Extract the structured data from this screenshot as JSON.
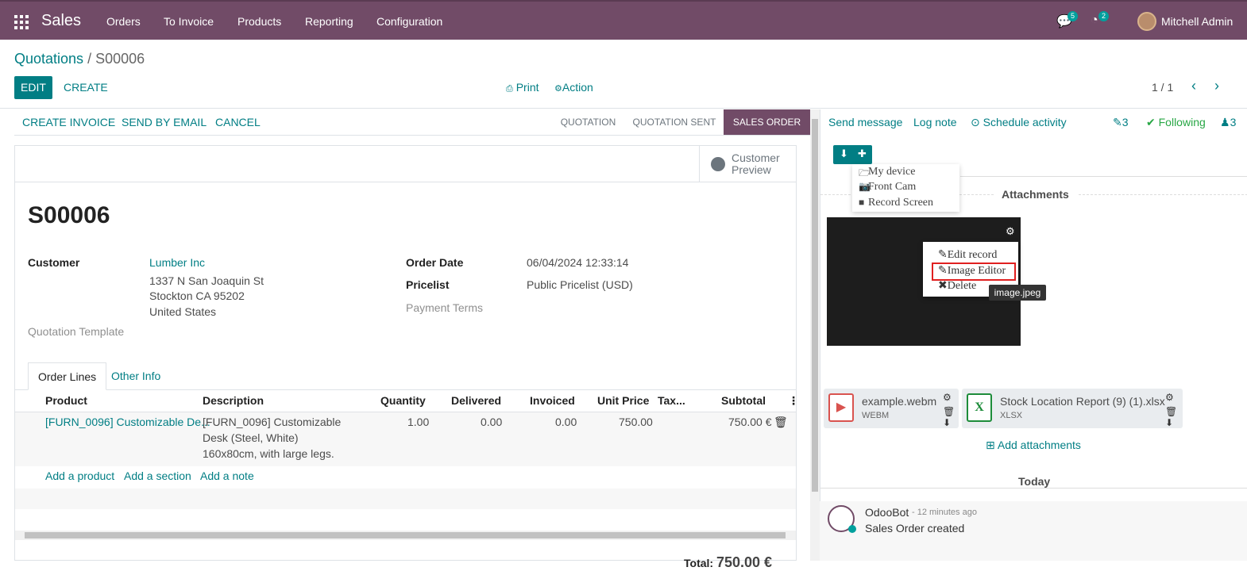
{
  "topbar": {
    "brand": "Sales",
    "menu": [
      "Orders",
      "To Invoice",
      "Products",
      "Reporting",
      "Configuration"
    ],
    "messages_count": "5",
    "activities_count": "2",
    "user": "Mitchell Admin"
  },
  "breadcrumb": {
    "parent": "Quotations",
    "separator": "/",
    "current": "S00006"
  },
  "actions": {
    "edit": "EDIT",
    "create": "CREATE",
    "print": "Print",
    "action": "Action"
  },
  "pager": {
    "text": "1 / 1",
    "prev": "‹",
    "next": "›"
  },
  "status_buttons": [
    "CREATE INVOICE",
    "SEND BY EMAIL",
    "CANCEL"
  ],
  "stages": {
    "items": [
      "QUOTATION",
      "QUOTATION SENT",
      "SALES ORDER"
    ],
    "active": "SALES ORDER"
  },
  "smart_button": {
    "label": "Customer Preview"
  },
  "record": {
    "name": "S00006",
    "customer_label": "Customer",
    "customer_name": "Lumber Inc",
    "address": [
      "1337 N San Joaquin St",
      "Stockton CA 95202",
      "United States"
    ],
    "template_label": "Quotation Template",
    "order_date_label": "Order Date",
    "order_date": "06/04/2024 12:33:14",
    "pricelist_label": "Pricelist",
    "pricelist": "Public Pricelist (USD)",
    "payment_terms_label": "Payment Terms"
  },
  "tabs": [
    "Order Lines",
    "Other Info"
  ],
  "table": {
    "headers": [
      "Product",
      "Description",
      "Quantity",
      "Delivered",
      "Invoiced",
      "Unit Price",
      "Tax...",
      "Subtotal"
    ],
    "row": {
      "product": "[FURN_0096] Customizable De...",
      "description": [
        "[FURN_0096] Customizable",
        "Desk (Steel, White)",
        "160x80cm, with large legs."
      ],
      "quantity": "1.00",
      "delivered": "0.00",
      "invoiced": "0.00",
      "unit_price": "750.00",
      "subtotal": "750.00 €"
    },
    "add_links": [
      "Add a product",
      "Add a section",
      "Add a note"
    ]
  },
  "total": {
    "label": "Total:",
    "value": "750.00 €"
  },
  "chatter": {
    "send_message": "Send message",
    "log_note": "Log note",
    "schedule_activity": "Schedule activity",
    "attachments_count": "3",
    "following": "Following",
    "followers_count": "3",
    "upload_menu": [
      "My device",
      "Front Cam",
      "Record Screen"
    ],
    "attachments_title": "Attachments",
    "image_menu": [
      "Edit record",
      "Image Editor",
      "Delete"
    ],
    "tooltip": "image.jpeg",
    "files": [
      {
        "name": "example.webm",
        "type": "WEBM"
      },
      {
        "name": "Stock Location Report (9) (1).xlsx",
        "type": "XLSX"
      }
    ],
    "add_attachments": "Add attachments",
    "today": "Today",
    "message": {
      "author": "OdooBot",
      "ago": "- 12 minutes ago",
      "body": "Sales Order created"
    }
  },
  "colors": {
    "brand": "#714B67",
    "accent": "#017e84",
    "highlight": "#e02020"
  }
}
